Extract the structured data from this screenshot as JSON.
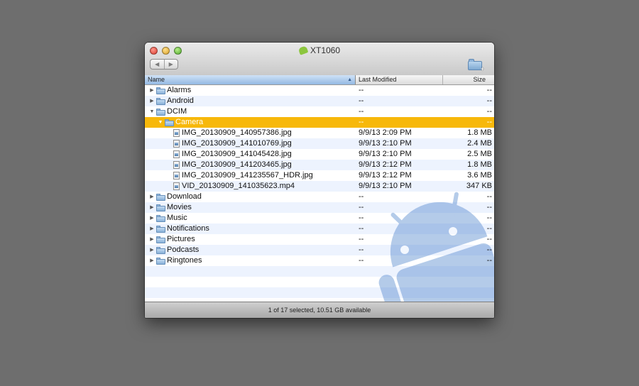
{
  "window": {
    "title": "XT1060"
  },
  "toolbar": {
    "back_glyph": "◀",
    "forward_glyph": "▶",
    "new_folder_icon": "new-folder-icon"
  },
  "columns": {
    "name": "Name",
    "date": "Last Modified",
    "size": "Size"
  },
  "sort_indicator": "▲",
  "rows": [
    {
      "type": "folder",
      "name": "Alarms",
      "date": "--",
      "size": "--",
      "disclosure": "▶",
      "indent": 0
    },
    {
      "type": "folder",
      "name": "Android",
      "date": "--",
      "size": "--",
      "disclosure": "▶",
      "indent": 0
    },
    {
      "type": "folder",
      "name": "DCIM",
      "date": "--",
      "size": "--",
      "disclosure": "▼",
      "indent": 0
    },
    {
      "type": "folder",
      "name": "Camera",
      "date": "--",
      "size": "--",
      "disclosure": "▼",
      "indent": 1,
      "selected": true
    },
    {
      "type": "file",
      "name": "IMG_20130909_140957386.jpg",
      "date": "9/9/13 2:09 PM",
      "size": "1.8 MB",
      "disclosure": "",
      "indent": 2
    },
    {
      "type": "file",
      "name": "IMG_20130909_141010769.jpg",
      "date": "9/9/13 2:10 PM",
      "size": "2.4 MB",
      "disclosure": "",
      "indent": 2
    },
    {
      "type": "file",
      "name": "IMG_20130909_141045428.jpg",
      "date": "9/9/13 2:10 PM",
      "size": "2.5 MB",
      "disclosure": "",
      "indent": 2
    },
    {
      "type": "file",
      "name": "IMG_20130909_141203465.jpg",
      "date": "9/9/13 2:12 PM",
      "size": "1.8 MB",
      "disclosure": "",
      "indent": 2
    },
    {
      "type": "file",
      "name": "IMG_20130909_141235567_HDR.jpg",
      "date": "9/9/13 2:12 PM",
      "size": "3.6 MB",
      "disclosure": "",
      "indent": 2
    },
    {
      "type": "file",
      "name": "VID_20130909_141035623.mp4",
      "date": "9/9/13 2:10 PM",
      "size": "347 KB",
      "disclosure": "",
      "indent": 2
    },
    {
      "type": "folder",
      "name": "Download",
      "date": "--",
      "size": "--",
      "disclosure": "▶",
      "indent": 0
    },
    {
      "type": "folder",
      "name": "Movies",
      "date": "--",
      "size": "--",
      "disclosure": "▶",
      "indent": 0
    },
    {
      "type": "folder",
      "name": "Music",
      "date": "--",
      "size": "--",
      "disclosure": "▶",
      "indent": 0
    },
    {
      "type": "folder",
      "name": "Notifications",
      "date": "--",
      "size": "--",
      "disclosure": "▶",
      "indent": 0
    },
    {
      "type": "folder",
      "name": "Pictures",
      "date": "--",
      "size": "--",
      "disclosure": "▶",
      "indent": 0
    },
    {
      "type": "folder",
      "name": "Podcasts",
      "date": "--",
      "size": "--",
      "disclosure": "▶",
      "indent": 0
    },
    {
      "type": "folder",
      "name": "Ringtones",
      "date": "--",
      "size": "--",
      "disclosure": "▶",
      "indent": 0
    }
  ],
  "status": "1 of 17 selected, 10.51 GB available",
  "colors": {
    "selection": "#f7b80a",
    "stripe": "#edf3fe",
    "header_active": "#94b9e3",
    "watermark": "#3c78c8"
  }
}
